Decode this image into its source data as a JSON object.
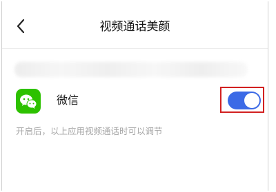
{
  "header": {
    "title": "视频通话美颜",
    "back_icon": "chevron-left-icon"
  },
  "app_row": {
    "label": "微信",
    "icon": "wechat-icon",
    "icon_color": "#2dc100",
    "toggle_on": true,
    "toggle_color": "#3c6ae6",
    "highlight_color": "#d22020"
  },
  "hint": "开启后，以上应用视频通话时可以调节"
}
